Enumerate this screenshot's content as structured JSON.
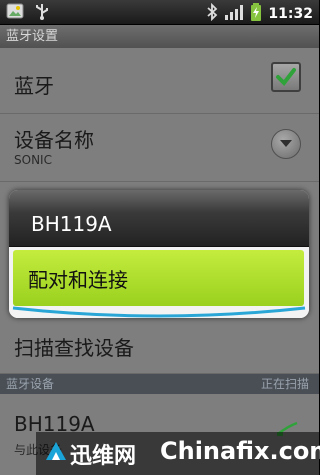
{
  "status_bar": {
    "time": "11:32",
    "left_icons": [
      "image-icon",
      "usb-icon"
    ],
    "right_icons": [
      "bluetooth-icon",
      "signal-icon",
      "battery-charging-icon"
    ]
  },
  "title_bar": {
    "title": "蓝牙设置"
  },
  "settings": {
    "bluetooth_label": "蓝牙",
    "device_name_label": "设备名称",
    "device_name_value": "SONIC",
    "scan_label": "扫描查找设备"
  },
  "section": {
    "label": "蓝牙设备",
    "status": "正在扫描"
  },
  "device": {
    "name": "BH119A",
    "sub": "与此设备"
  },
  "popup": {
    "title": "BH119A",
    "option": "配对和连接"
  },
  "watermark": {
    "text1": "迅维网",
    "text2": "Chinafix.com"
  },
  "colors": {
    "accent_green": "#a8dd2a",
    "check_green": "#2fa33a",
    "popup_blue_arc": "#2aa6d6"
  }
}
